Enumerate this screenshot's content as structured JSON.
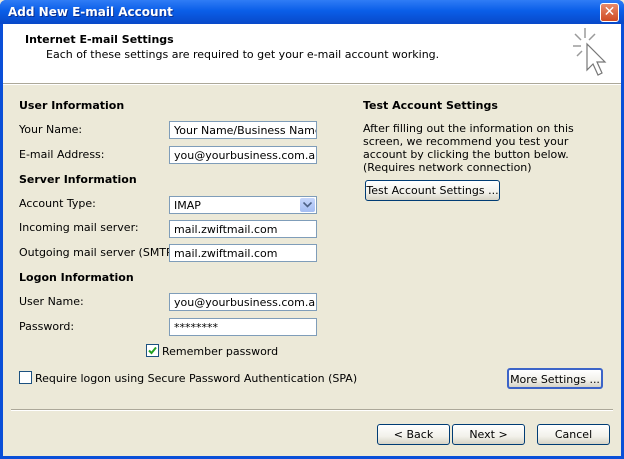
{
  "window": {
    "title": "Add New E-mail Account",
    "close_glyph": "✕"
  },
  "header": {
    "title": "Internet E-mail Settings",
    "subtitle": "Each of these settings are required to get your e-mail account working.",
    "icon": "cursor-sparkle-icon"
  },
  "user_info": {
    "heading": "User Information",
    "name_label": "Your Name:",
    "name_value": "Your Name/Business Name",
    "email_label": "E-mail Address:",
    "email_value": "you@yourbusiness.com.au"
  },
  "server_info": {
    "heading": "Server Information",
    "type_label": "Account Type:",
    "type_value": "IMAP",
    "incoming_label": "Incoming mail server:",
    "incoming_value": "mail.zwiftmail.com",
    "outgoing_label": "Outgoing mail server (SMTP):",
    "outgoing_value": "mail.zwiftmail.com"
  },
  "logon_info": {
    "heading": "Logon Information",
    "user_label": "User Name:",
    "user_value": "you@yourbusiness.com.au",
    "password_label": "Password:",
    "password_value": "********",
    "remember_label": "Remember password",
    "remember_checked": true,
    "spa_label": "Require logon using Secure Password Authentication (SPA)",
    "spa_checked": false
  },
  "test": {
    "heading": "Test Account Settings",
    "description": "After filling out the information on this screen, we recommend you test your account by clicking the button below. (Requires network connection)",
    "button_label": "Test Account Settings ..."
  },
  "buttons": {
    "more_settings": "More Settings ...",
    "back": "< Back",
    "next": "Next >",
    "cancel": "Cancel"
  },
  "colors": {
    "title_bar": "#0a5ee8",
    "dialog_bg": "#ece9d8",
    "check_mark": "#21a121"
  }
}
